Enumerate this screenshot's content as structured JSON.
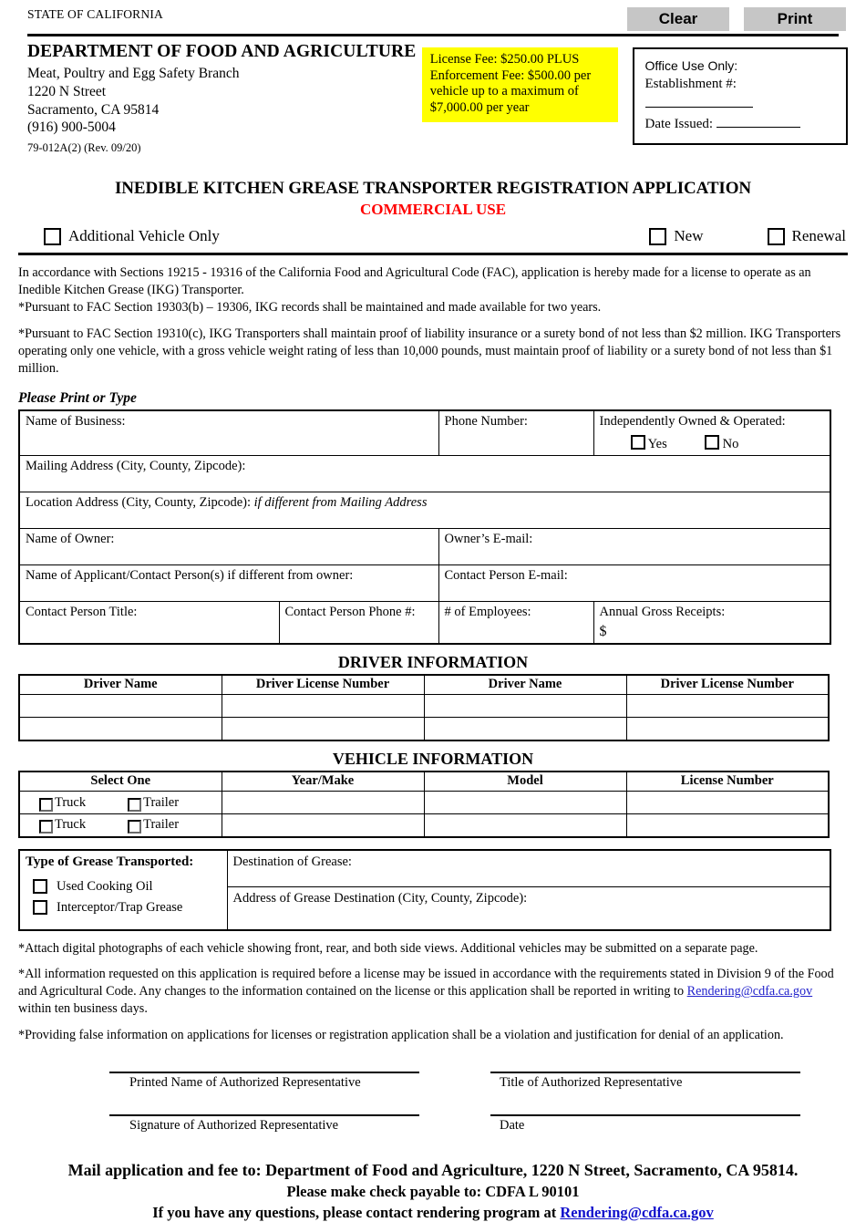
{
  "toolbar": {
    "clear_label": "Clear",
    "print_label": "Print"
  },
  "header": {
    "state_label": "STATE OF CALIFORNIA",
    "department": "DEPARTMENT OF FOOD AND AGRICULTURE",
    "branch": "Meat, Poultry and Egg Safety Branch",
    "street": "1220 N Street",
    "city_state_zip": "Sacramento, CA  95814",
    "phone": "(916) 900-5004",
    "form_number": "79-012A(2)  (Rev. 09/20)"
  },
  "fee_box": {
    "text": "License Fee: $250.00 PLUS Enforcement Fee: $500.00 per vehicle up to a maximum of $7,000.00 per year",
    "background_color": "#ffff00"
  },
  "office_use": {
    "title": "Office Use Only:",
    "establishment_label": "Establishment #:",
    "date_issued_label": "Date Issued:"
  },
  "title": {
    "main": "INEDIBLE KITCHEN GREASE TRANSPORTER REGISTRATION APPLICATION",
    "sub": "COMMERCIAL USE",
    "sub_color": "#ff0000"
  },
  "top_options": {
    "additional_vehicle": "Additional Vehicle Only",
    "new": "New",
    "renewal": "Renewal"
  },
  "intro": {
    "p1": "In accordance with Sections 19215 - 19316 of the California Food and Agricultural Code (FAC), application is hereby made for a license to operate as an Inedible Kitchen Grease (IKG) Transporter.",
    "p2": "*Pursuant to FAC Section 19303(b) – 19306, IKG records shall be maintained and made available for two years.",
    "p3": "*Pursuant to FAC Section 19310(c), IKG Transporters shall maintain proof of liability insurance or a surety bond of not less than $2 million. IKG Transporters operating only one vehicle, with a gross vehicle weight rating of less than 10,000 pounds, must maintain proof of liability or a surety bond of not less than $1 million."
  },
  "print_or_type": "Please Print or Type",
  "business": {
    "name_of_business": "Name of Business:",
    "phone_number": "Phone Number:",
    "independently_owned": "Independently Owned & Operated:",
    "yes": "Yes",
    "no": "No",
    "mailing_address": "Mailing Address (City, County, Zipcode):",
    "location_address": "Location Address (City, County, Zipcode):",
    "location_address_note": "if different from Mailing Address",
    "name_of_owner": "Name of Owner:",
    "owner_email": "Owner’s E-mail:",
    "applicant_name": "Name of Applicant/Contact Person(s) if different from owner:",
    "contact_email": "Contact Person E-mail:",
    "contact_title": "Contact Person Title:",
    "contact_phone": "Contact Person Phone #:",
    "employees": "# of Employees:",
    "gross_receipts": "Annual Gross Receipts:",
    "gross_receipts_symbol": "$"
  },
  "driver_section": {
    "title": "DRIVER INFORMATION",
    "columns": [
      "Driver Name",
      "Driver License Number",
      "Driver Name",
      "Driver License Number"
    ],
    "rows": [
      [
        "",
        "",
        "",
        ""
      ],
      [
        "",
        "",
        "",
        ""
      ]
    ]
  },
  "vehicle_section": {
    "title": "VEHICLE INFORMATION",
    "columns": [
      "Select One",
      "Year/Make",
      "Model",
      "License Number"
    ],
    "truck_label": "Truck",
    "trailer_label": "Trailer",
    "rows": [
      [
        "",
        "",
        ""
      ],
      [
        "",
        "",
        ""
      ]
    ]
  },
  "grease": {
    "type_title": "Type of Grease Transported:",
    "option_used_cooking_oil": "Used Cooking Oil",
    "option_interceptor": "Interceptor/Trap Grease",
    "destination_label": "Destination of Grease:",
    "destination_address_label": "Address of Grease Destination (City, County, Zipcode):"
  },
  "notes": {
    "n1": "*Attach digital photographs of each vehicle showing front, rear, and both side views. Additional vehicles may be submitted on a separate page.",
    "n2_before": "*All information requested on this application is required before a license may be issued in accordance with the requirements stated in Division 9 of the Food and Agricultural Code. Any changes to the information contained on the license or this application shall be reported in writing to ",
    "n2_email": "Rendering@cdfa.ca.gov",
    "n2_after": " within ten business days.",
    "n3": "*Providing false information on applications for licenses or registration application shall be a violation and justification for denial of an application."
  },
  "signature": {
    "printed_name": "Printed Name of Authorized Representative",
    "title": "Title of Authorized Representative",
    "signature": "Signature of Authorized Representative",
    "date": "Date"
  },
  "footer": {
    "line1": "Mail application and fee to: Department of Food and Agriculture, 1220 N Street, Sacramento, CA 95814.",
    "line2": "Please make check payable to: CDFA L 90101",
    "line3_before": "If you have any questions, please contact rendering program at ",
    "line3_email": "Rendering@cdfa.ca.gov"
  }
}
